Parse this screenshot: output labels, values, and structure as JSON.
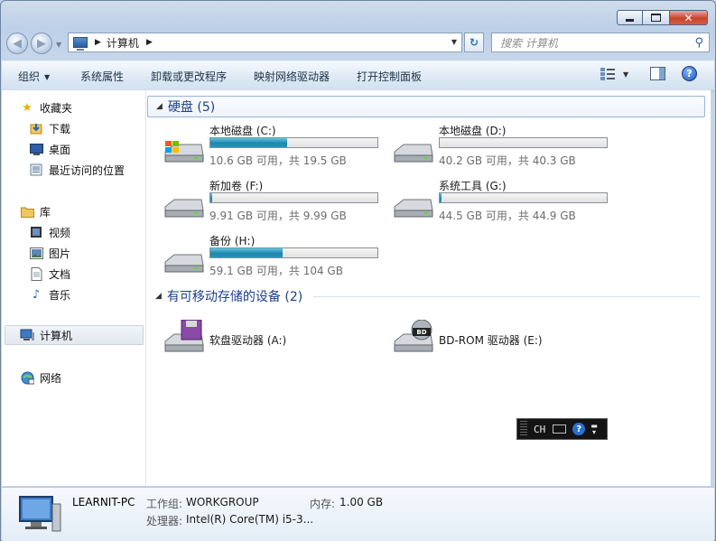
{
  "window": {
    "address_crumbs": [
      "计算机"
    ],
    "search_placeholder": "搜索 计算机"
  },
  "toolbar": {
    "organize": "组织",
    "system_properties": "系统属性",
    "uninstall": "卸载或更改程序",
    "map_drive": "映射网络驱动器",
    "control_panel": "打开控制面板"
  },
  "sidebar": {
    "favorites": {
      "label": "收藏夹",
      "items": [
        {
          "label": "下载",
          "icon": "download-folder-icon"
        },
        {
          "label": "桌面",
          "icon": "desktop-icon"
        },
        {
          "label": "最近访问的位置",
          "icon": "recent-places-icon"
        }
      ]
    },
    "libraries": {
      "label": "库",
      "items": [
        {
          "label": "视频",
          "icon": "video-icon"
        },
        {
          "label": "图片",
          "icon": "pictures-icon"
        },
        {
          "label": "文档",
          "icon": "documents-icon"
        },
        {
          "label": "音乐",
          "icon": "music-icon"
        }
      ]
    },
    "computer": {
      "label": "计算机",
      "selected": true
    },
    "network": {
      "label": "网络"
    }
  },
  "groups": {
    "hard_disks": "硬盘 (5)",
    "removable": "有可移动存储的设备 (2)"
  },
  "drives": [
    {
      "name": "本地磁盘 (C:)",
      "size": "10.6 GB 可用，共 19.5 GB",
      "used_fraction": 0.46,
      "system": true
    },
    {
      "name": "本地磁盘 (D:)",
      "size": "40.2 GB 可用，共 40.3 GB",
      "used_fraction": 0.0
    },
    {
      "name": "新加卷 (F:)",
      "size": "9.91 GB 可用，共 9.99 GB",
      "used_fraction": 0.01
    },
    {
      "name": "系统工具 (G:)",
      "size": "44.5 GB 可用，共 44.9 GB",
      "used_fraction": 0.01
    },
    {
      "name": "备份 (H:)",
      "size": "59.1 GB 可用，共 104 GB",
      "used_fraction": 0.43
    }
  ],
  "devices": [
    {
      "name": "软盘驱动器 (A:)",
      "icon": "floppy-drive-icon"
    },
    {
      "name": "BD-ROM 驱动器 (E:)",
      "icon": "bd-rom-drive-icon"
    }
  ],
  "ime": {
    "mode": "CH"
  },
  "details": {
    "computer_name": "LEARNIT-PC",
    "workgroup_label": "工作组:",
    "workgroup_value": "WORKGROUP",
    "memory_label": "内存:",
    "memory_value": "1.00 GB",
    "processor_label": "处理器:",
    "processor_value": "Intel(R) Core(TM) i5-3..."
  },
  "colors": {
    "accent": "#1e3f8c",
    "drive_bar": "#1e86ad"
  }
}
